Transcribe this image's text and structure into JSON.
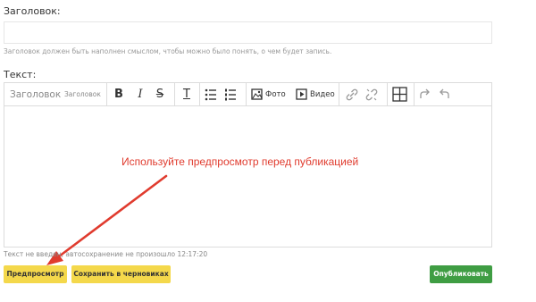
{
  "form": {
    "title_label": "Заголовок:",
    "title_value": "",
    "title_hint": "Заголовок должен быть наполнен смыслом, чтобы можно было понять, о чем будет запись.",
    "text_label": "Текст:"
  },
  "toolbar": {
    "heading_large": "Заголовок",
    "heading_small": "Заголовок",
    "bold_icon": "B",
    "italic_icon": "I",
    "strike_icon": "S",
    "clear_format_icon": "T",
    "photo_label": "Фото",
    "video_label": "Видео",
    "icons": [
      "bold-icon",
      "italic-icon",
      "strikethrough-icon",
      "clear-format-icon",
      "bullet-list-icon",
      "numbered-list-icon",
      "image-icon",
      "video-icon",
      "link-icon",
      "unlink-icon",
      "table-icon",
      "redo-icon",
      "undo-icon"
    ]
  },
  "annotation": {
    "text": "Используйте предпросмотр перед публикацией",
    "color": "#e03b2e"
  },
  "status": {
    "text": "Текст не введен, автосохранение не произошло 12:17:20"
  },
  "buttons": {
    "preview": "Предпросмотр",
    "save_draft": "Сохранить в черновиках",
    "publish": "Опубликовать"
  },
  "colors": {
    "yellow_button": "#f4d84b",
    "green_button": "#3f9d43"
  }
}
